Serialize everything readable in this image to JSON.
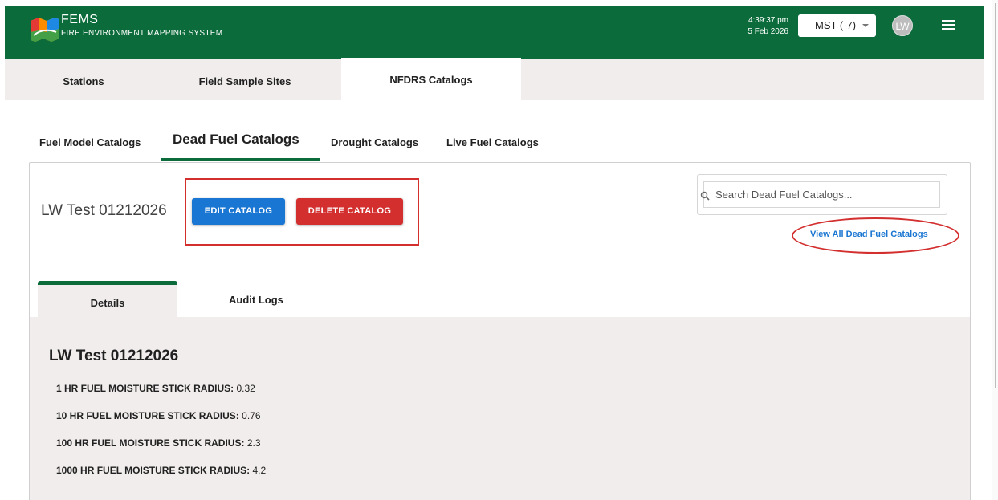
{
  "header": {
    "brand_title": "FEMS",
    "brand_subtitle": "FIRE ENVIRONMENT MAPPING SYSTEM",
    "time": "4:39:37 pm",
    "date": "5 Feb 2026",
    "timezone": "MST (-7)",
    "avatar_initials": "LW",
    "accent_color": "#0b6b3a"
  },
  "top_tabs": [
    {
      "label": "Stations"
    },
    {
      "label": "Field Sample Sites"
    },
    {
      "label": "NFDRS Catalogs",
      "active": true
    }
  ],
  "sub_tabs": [
    {
      "label": "Fuel Model Catalogs"
    },
    {
      "label": "Dead Fuel Catalogs",
      "active": true
    },
    {
      "label": "Drought Catalogs"
    },
    {
      "label": "Live Fuel Catalogs"
    }
  ],
  "catalog": {
    "name": "LW Test 01212026",
    "edit_label": "EDIT CATALOG",
    "delete_label": "DELETE CATALOG"
  },
  "search": {
    "placeholder": "Search Dead Fuel Catalogs...",
    "view_all_label": "View All Dead Fuel Catalogs"
  },
  "detail_tabs": [
    {
      "label": "Details",
      "active": true
    },
    {
      "label": "Audit Logs"
    }
  ],
  "details": {
    "title": "LW Test 01212026",
    "properties": [
      {
        "label": "1 HR FUEL MOISTURE STICK RADIUS:",
        "value": "0.32"
      },
      {
        "label": "10 HR FUEL MOISTURE STICK RADIUS:",
        "value": "0.76"
      },
      {
        "label": "100 HR FUEL MOISTURE STICK RADIUS:",
        "value": "2.3"
      },
      {
        "label": "1000 HR FUEL MOISTURE STICK RADIUS:",
        "value": "4.2"
      }
    ]
  },
  "colors": {
    "primary_button": "#1976d2",
    "danger_button": "#d32f2f",
    "annotation": "#d32f2f"
  },
  "icons": [
    "fems-logo-icon",
    "chevron-down-icon",
    "hamburger-menu-icon",
    "search-icon"
  ]
}
